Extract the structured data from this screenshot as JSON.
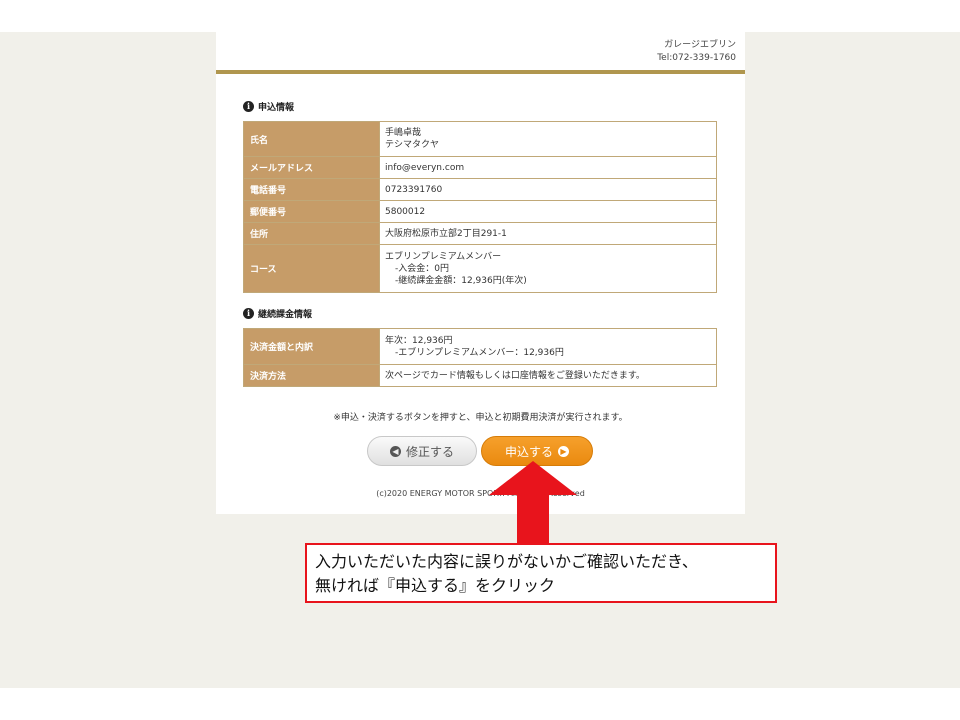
{
  "header": {
    "shop_name": "ガレージエブリン",
    "tel": "Tel:072-339-1760"
  },
  "application": {
    "section_title": "申込情報",
    "rows": [
      {
        "label": "氏名",
        "lines": [
          "手嶋卓哉",
          "テシマタクヤ"
        ]
      },
      {
        "label": "メールアドレス",
        "lines": [
          "info@everyn.com"
        ]
      },
      {
        "label": "電話番号",
        "lines": [
          "0723391760"
        ]
      },
      {
        "label": "郵便番号",
        "lines": [
          "5800012"
        ]
      },
      {
        "label": "住所",
        "lines": [
          "大阪府松原市立部2丁目291-1"
        ]
      },
      {
        "label": "コース",
        "lines": [
          "エブリンプレミアムメンバー",
          "-入会金：0円",
          "-継続課金金額：12,936円(年次)"
        ]
      }
    ]
  },
  "billing": {
    "section_title": "継続課金情報",
    "rows": [
      {
        "label": "決済金額と内訳",
        "lines": [
          "年次：12,936円",
          "-エブリンプレミアムメンバー：12,936円"
        ]
      },
      {
        "label": "決済方法",
        "lines": [
          "次ページでカード情報もしくは口座情報をご登録いただきます。"
        ]
      }
    ]
  },
  "notice": "※申込・決済するボタンを押すと、申込と初期費用決済が実行されます。",
  "buttons": {
    "back_label": "修正する",
    "submit_label": "申込する"
  },
  "footer": {
    "copyright": "(c)2020 ENERGY MOTOR SPORT. All Rights Reserved"
  },
  "callout": {
    "line1": "入力いただいた内容に誤りがないかご確認いただき、",
    "line2": "無ければ『申込する』をクリック"
  },
  "colors": {
    "gold_bar": "#b0964e",
    "label_bg": "#c69c68",
    "submit_button": "#ea8a10",
    "arrow": "#e8141c"
  }
}
